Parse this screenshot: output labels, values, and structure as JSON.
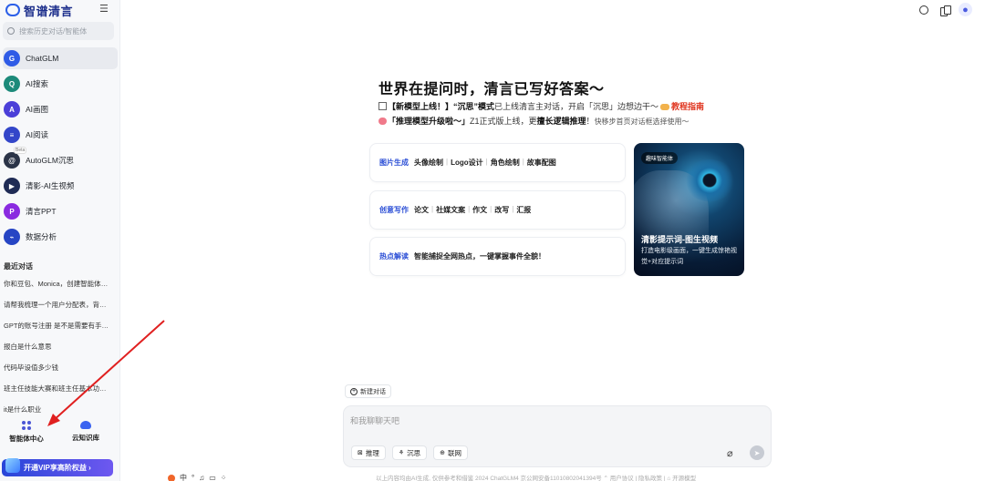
{
  "brand": {
    "name": "智谱清言"
  },
  "search": {
    "placeholder": "搜索历史对话/智能体"
  },
  "nav": {
    "items": [
      {
        "label": "ChatGLM",
        "icon": "chatglm-icon",
        "color": "#2f5be6",
        "glyph": "G"
      },
      {
        "label": "AI搜索",
        "icon": "ai-search-icon",
        "color": "#1c8a7a",
        "glyph": "Q"
      },
      {
        "label": "AI画图",
        "icon": "ai-draw-icon",
        "color": "#4b3fd8",
        "glyph": "A"
      },
      {
        "label": "AI阅读",
        "icon": "ai-read-icon",
        "color": "#3346c9",
        "glyph": "≡"
      },
      {
        "label": "AutoGLM沉思",
        "icon": "autoglm-icon",
        "color": "#2b3448",
        "glyph": "@",
        "badge": "Beta"
      },
      {
        "label": "清影-AI生视频",
        "icon": "video-icon",
        "color": "#1f2b55",
        "glyph": "▶"
      },
      {
        "label": "清言PPT",
        "icon": "ppt-icon",
        "color": "#8a2ae0",
        "glyph": "P"
      },
      {
        "label": "数据分析",
        "icon": "data-analysis-icon",
        "color": "#2645c4",
        "glyph": "⌁"
      }
    ]
  },
  "recent": {
    "title": "最近对话",
    "items": [
      "你和豆包、Monica，创建智能体需要什么条件",
      "请帮我梳理一个用户分配表，背景是",
      "GPT的账号注册 是不是需要有手机号",
      "报白是什么意思",
      "代码毕设值多少钱",
      "班主任技能大赛和班主任基本功大赛",
      "it是什么职业"
    ]
  },
  "bottom_tabs": [
    {
      "label": "智能体中心",
      "icon": "agent-center-icon"
    },
    {
      "label": "云知识库",
      "icon": "cloud-kb-icon"
    }
  ],
  "vip": {
    "label": "开通VIP享高阶权益 ›"
  },
  "top_icons": [
    "alarm-icon",
    "docs-icon",
    "user-icon"
  ],
  "hero": {
    "title": "世界在提问时，清言已写好答案〜",
    "line1": {
      "a": "【新模型上线！】“沉思”模式",
      "b": "已上线清言主对话，开启「沉思」边想边干〜",
      "c": "教程指南"
    },
    "line2": {
      "a": "「推理模型升级啦〜」",
      "b": "Z1正式版上线，更",
      "c": "擅长逻辑推理",
      "d": "！",
      "e": "快移步首页对话框选择使用〜"
    }
  },
  "cards": [
    {
      "tag": "图片生成",
      "items": [
        "头像绘制",
        "Logo设计",
        "角色绘制",
        "故事配图"
      ]
    },
    {
      "tag": "创意写作",
      "items": [
        "论文",
        "社媒文案",
        "作文",
        "改写",
        "汇报"
      ]
    },
    {
      "tag": "热点解读",
      "items": [
        "智能捕捉全网热点，一键掌握事件全貌！"
      ]
    }
  ],
  "promo": {
    "badge": "趣味智能体",
    "title": "清影提示词-图生视频",
    "subtitle": "打造电影级画面，一键生成惊艳视觉+对应提示词"
  },
  "composer": {
    "new_chat": "新建对话",
    "placeholder": "和我聊聊天吧",
    "chips": [
      {
        "label": "推理",
        "icon": "reasoning-icon",
        "glyph": "⊠"
      },
      {
        "label": "沉思",
        "icon": "deep-think-icon",
        "glyph": "⚘"
      },
      {
        "label": "联网",
        "icon": "web-icon",
        "glyph": "⊕"
      }
    ]
  },
  "footer": {
    "text": "以上内容均由AI生成, 仅供参考和借鉴    2024 ChatGLM4 京公网安备11010802041394号 ⌃ 用户协议 | 隐私政策 | ⌂ 开源模型"
  },
  "ime": {
    "items": [
      "中",
      "°",
      "♫",
      "▭",
      "⁘"
    ]
  }
}
